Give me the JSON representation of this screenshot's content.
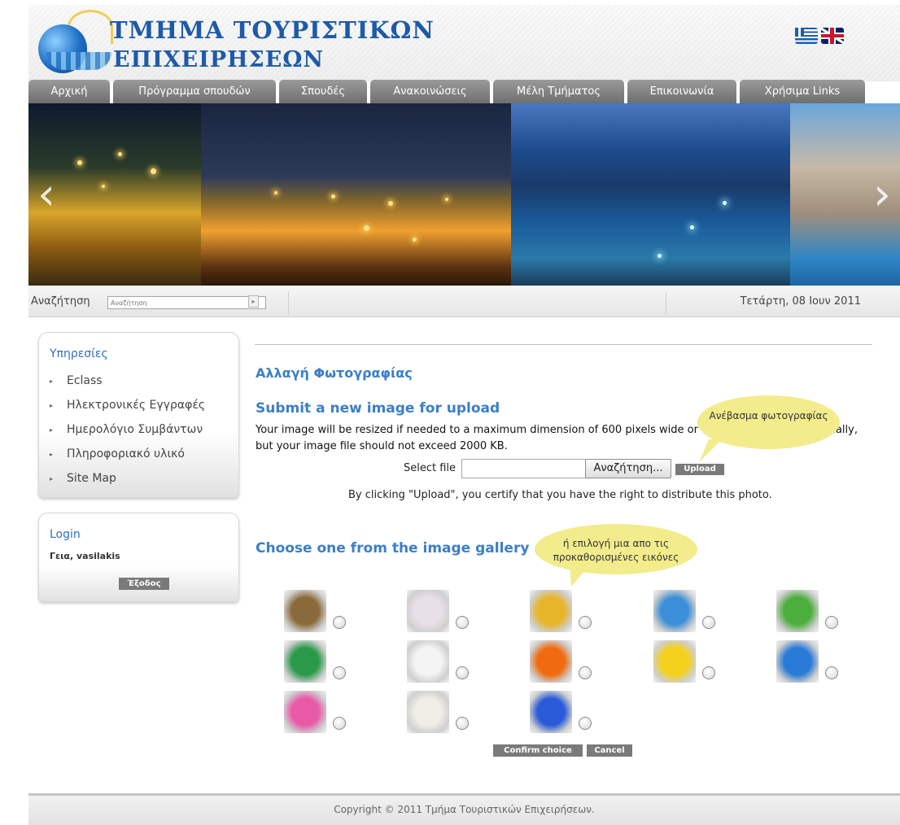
{
  "header": {
    "logo_line1": "ΤΜΗΜΑ ΤΟΥΡΙΣΤΙΚΩΝ",
    "logo_line2": "ΕΠΙΧΕΙΡΗΣΕΩΝ",
    "flags": [
      "greek-flag-icon",
      "uk-flag-icon"
    ]
  },
  "nav": {
    "tabs": [
      {
        "label": "Αρχική"
      },
      {
        "label": "Πρόγραμμα σπουδών"
      },
      {
        "label": "Σπουδές"
      },
      {
        "label": "Ανακοινώσεις"
      },
      {
        "label": "Μέλη Τμήματος"
      },
      {
        "label": "Επικοινωνία"
      },
      {
        "label": "Χρήσιμα Links"
      }
    ]
  },
  "slider": {
    "prev_icon": "‹",
    "next_icon": "›"
  },
  "searchbar": {
    "label": "Αναζήτηση",
    "placeholder": "Αναζήτηση",
    "go_icon": "▸",
    "date": "Τετάρτη, 08 Ιουν 2011"
  },
  "sidebar": {
    "services_title": "Υπηρεσίες",
    "services": [
      {
        "label": "Eclass"
      },
      {
        "label": "Ηλεκτρονικές Εγγραφές"
      },
      {
        "label": "Ημερολόγιο Συμβάντων"
      },
      {
        "label": "Πληροφοριακό υλικό"
      },
      {
        "label": "Site Map"
      }
    ],
    "login_title": "Login",
    "greeting": "Γεια, vasilakis",
    "logout_label": "Έξοδος"
  },
  "main": {
    "title": "Αλλαγή Φωτογραφίας",
    "upload_heading": "Submit a new image for upload",
    "description": "Your image will be resized if needed to a maximum dimension of 600 pixels wide or 600 pixels tall, automatically, but your image file should not exceed 2000 KB.",
    "select_file_label": "Select file",
    "browse_label": "Αναζήτηση...",
    "upload_label": "Upload",
    "certify_text": "By clicking \"Upload\", you certify that you have the right to distribute this photo.",
    "gallery_heading": "Choose one from the image gallery",
    "confirm_label": "Confirm choice",
    "cancel_label": "Cancel"
  },
  "callouts": {
    "upload_note": "Ανέβασμα φωτογραφίας",
    "gallery_note_1": "ή επιλογή μια απο τις",
    "gallery_note_2": "προκαθορισμένες εικόνες"
  },
  "gallery": {
    "thumbnails": [
      {
        "name": "guitar-thumbnail",
        "color": "#8a6a3a"
      },
      {
        "name": "karate-thumbnail",
        "color": "#e8e0e8"
      },
      {
        "name": "race-car-thumbnail",
        "color": "#e7b52a"
      },
      {
        "name": "airplane-thumbnail",
        "color": "#3a8fd8"
      },
      {
        "name": "frog-thumbnail",
        "color": "#4cae3c"
      },
      {
        "name": "skateboarder-thumbnail",
        "color": "#2a9a4a"
      },
      {
        "name": "soccer-ball-thumbnail",
        "color": "#f4f4f4"
      },
      {
        "name": "flower-thumbnail",
        "color": "#f06a10"
      },
      {
        "name": "rubber-duck-thumbnail",
        "color": "#f4d11c"
      },
      {
        "name": "fish-thumbnail",
        "color": "#2a7ad8"
      },
      {
        "name": "pink-flower-thumbnail",
        "color": "#e85aa8"
      },
      {
        "name": "dog-thumbnail",
        "color": "#f0ece6"
      },
      {
        "name": "butterfly-thumbnail",
        "color": "#2a5ad8"
      }
    ]
  },
  "footer": {
    "copyright": "Copyright © 2011 Τμήμα Τουριστικών Επιχειρήσεων."
  }
}
